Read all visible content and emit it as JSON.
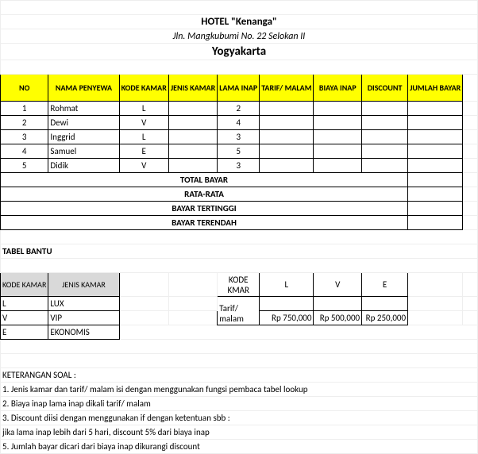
{
  "header": {
    "line1": "HOTEL \"Kenanga\"",
    "line2": "Jln. Mangkubumi No. 22 Selokan II",
    "line3": "Yogyakarta"
  },
  "columns": {
    "no": "NO",
    "nama": "NAMA PENYEWA",
    "kode": "KODE KAMAR",
    "jenis": "JENIS KAMAR",
    "lama": "LAMA INAP",
    "tarif": "TARIF/ MALAM",
    "biaya": "BIAYA INAP",
    "disc": "DISCOUNT",
    "jumlah": "JUMLAH BAYAR"
  },
  "rows": [
    {
      "no": "1",
      "nama": "Rohmat",
      "kode": "L",
      "lama": "2"
    },
    {
      "no": "2",
      "nama": "Dewi",
      "kode": "V",
      "lama": "4"
    },
    {
      "no": "3",
      "nama": "Inggrid",
      "kode": "L",
      "lama": "3"
    },
    {
      "no": "4",
      "nama": "Samuel",
      "kode": "E",
      "lama": "5"
    },
    {
      "no": "5",
      "nama": "Didik",
      "kode": "V",
      "lama": "3"
    }
  ],
  "summary": {
    "total": "TOTAL BAYAR",
    "rata": "RATA-RATA",
    "tinggi": "BAYAR TERTINGGI",
    "rendah": "BAYAR TERENDAH"
  },
  "bantu": {
    "title": "TABEL BANTU",
    "left_hdr_kode": "KODE KAMAR",
    "left_hdr_jenis": "JENIS KAMAR",
    "left_rows": [
      {
        "k": "L",
        "j": "LUX"
      },
      {
        "k": "V",
        "j": "VIP"
      },
      {
        "k": "E",
        "j": "EKONOMIS"
      }
    ],
    "right_hdr_kode": "KODE KMAR",
    "right_cols": [
      "L",
      "V",
      "E"
    ],
    "right_tarif_label": "Tarif/ malam",
    "right_tarif": [
      "Rp 750,000",
      "Rp 500,000",
      "Rp  250,000"
    ]
  },
  "ket": {
    "title": "KETERANGAN SOAL :",
    "items": [
      "1. Jenis kamar dan tarif/ malam isi dengan menggunakan fungsi pembaca tabel lookup",
      "2. Biaya inap lama inap dikali tarif/ malam",
      "3. Discount diisi dengan menggunakan if dengan ketentuan sbb :",
      "    jika lama inap lebih dari 5 hari, discount 5% dari biaya inap",
      "5. Jumlah bayar dicari dari biaya inap dikurangi discount"
    ]
  },
  "chart_data": {
    "type": "table",
    "title": "HOTEL \"Kenanga\" - Daftar Penyewa",
    "columns": [
      "NO",
      "NAMA PENYEWA",
      "KODE KAMAR",
      "JENIS KAMAR",
      "LAMA INAP",
      "TARIF/ MALAM",
      "BIAYA INAP",
      "DISCOUNT",
      "JUMLAH BAYAR"
    ],
    "rows": [
      [
        1,
        "Rohmat",
        "L",
        null,
        2,
        null,
        null,
        null,
        null
      ],
      [
        2,
        "Dewi",
        "V",
        null,
        4,
        null,
        null,
        null,
        null
      ],
      [
        3,
        "Inggrid",
        "L",
        null,
        3,
        null,
        null,
        null,
        null
      ],
      [
        4,
        "Samuel",
        "E",
        null,
        5,
        null,
        null,
        null,
        null
      ],
      [
        5,
        "Didik",
        "V",
        null,
        3,
        null,
        null,
        null,
        null
      ]
    ],
    "lookup_jenis": {
      "L": "LUX",
      "V": "VIP",
      "E": "EKONOMIS"
    },
    "lookup_tarif": {
      "L": 750000,
      "V": 500000,
      "E": 250000
    }
  }
}
